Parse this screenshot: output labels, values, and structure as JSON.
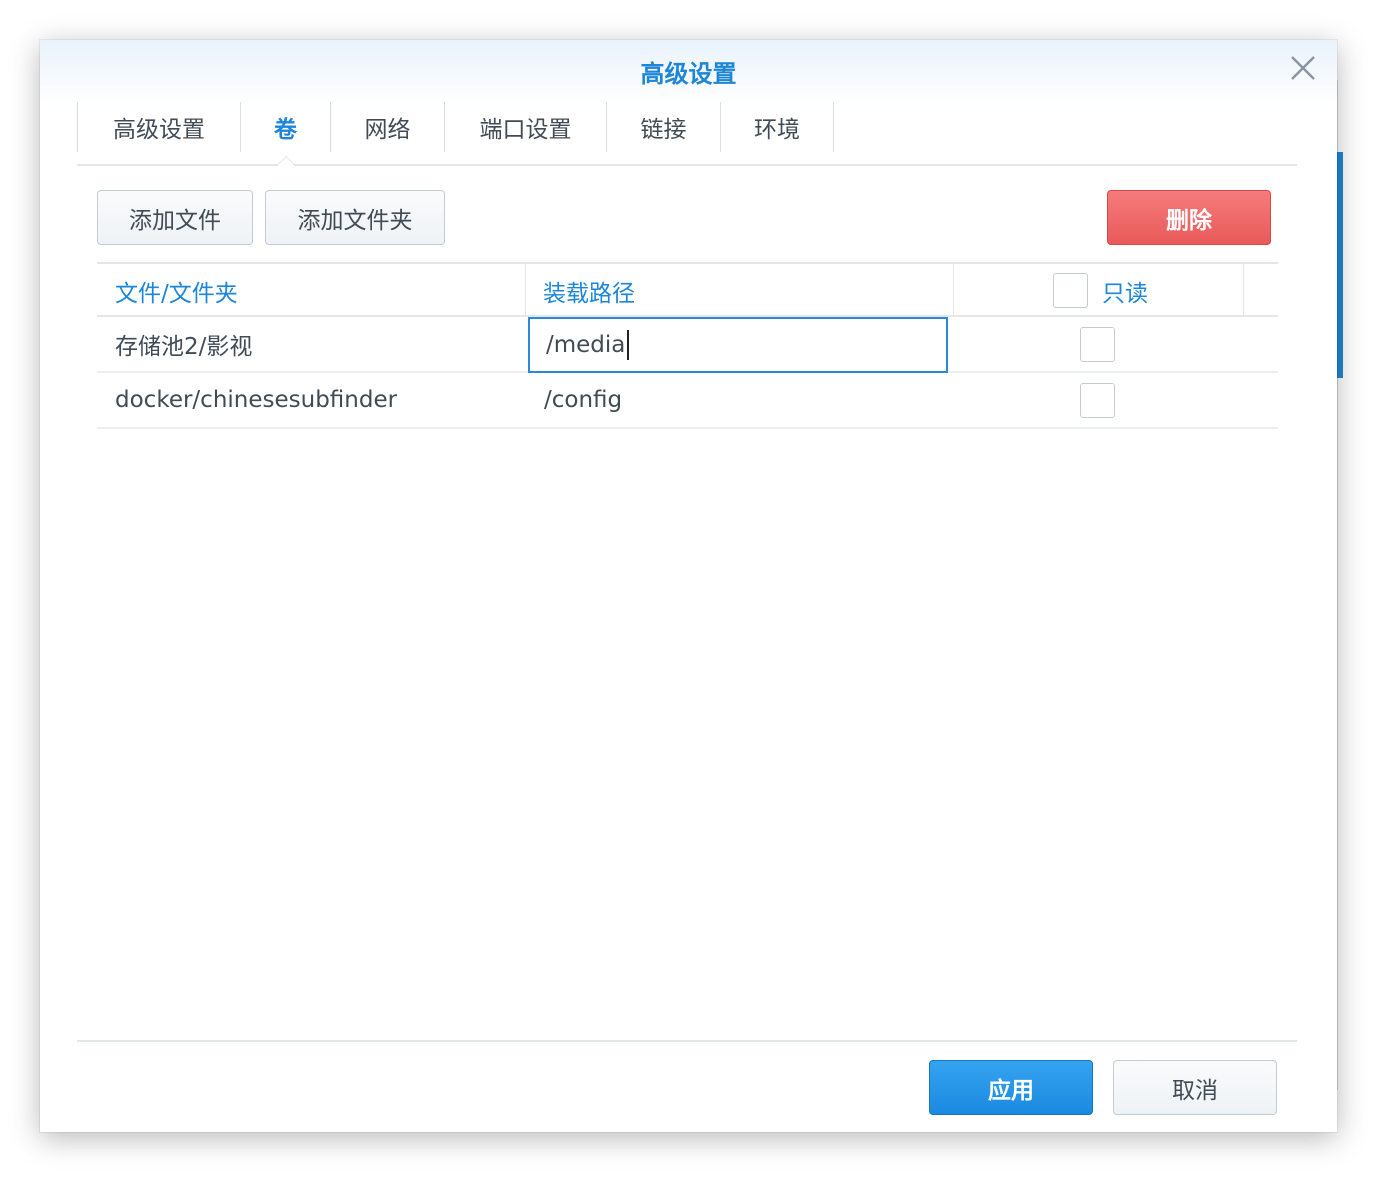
{
  "dialog": {
    "title": "高级设置"
  },
  "tabs": [
    {
      "label": "高级设置",
      "active": false
    },
    {
      "label": "卷",
      "active": true
    },
    {
      "label": "网络",
      "active": false
    },
    {
      "label": "端口设置",
      "active": false
    },
    {
      "label": "链接",
      "active": false
    },
    {
      "label": "环境",
      "active": false
    }
  ],
  "toolbar": {
    "add_file_label": "添加文件",
    "add_folder_label": "添加文件夹",
    "delete_label": "删除"
  },
  "table": {
    "columns": [
      "文件/文件夹",
      "装载路径",
      "只读"
    ],
    "header_readonly_checked": false,
    "rows": [
      {
        "file": "存储池2/影视",
        "mount_path": "/media",
        "readonly": false,
        "editing": true
      },
      {
        "file": "docker/chinesesubfinder",
        "mount_path": "/config",
        "readonly": false,
        "editing": false
      }
    ]
  },
  "footer": {
    "apply_label": "应用",
    "cancel_label": "取消"
  },
  "colors": {
    "accent": "#1d86d8",
    "danger": "#e95a5a",
    "primary": "#1a8ae0"
  },
  "icons": {
    "close": "close-icon"
  }
}
